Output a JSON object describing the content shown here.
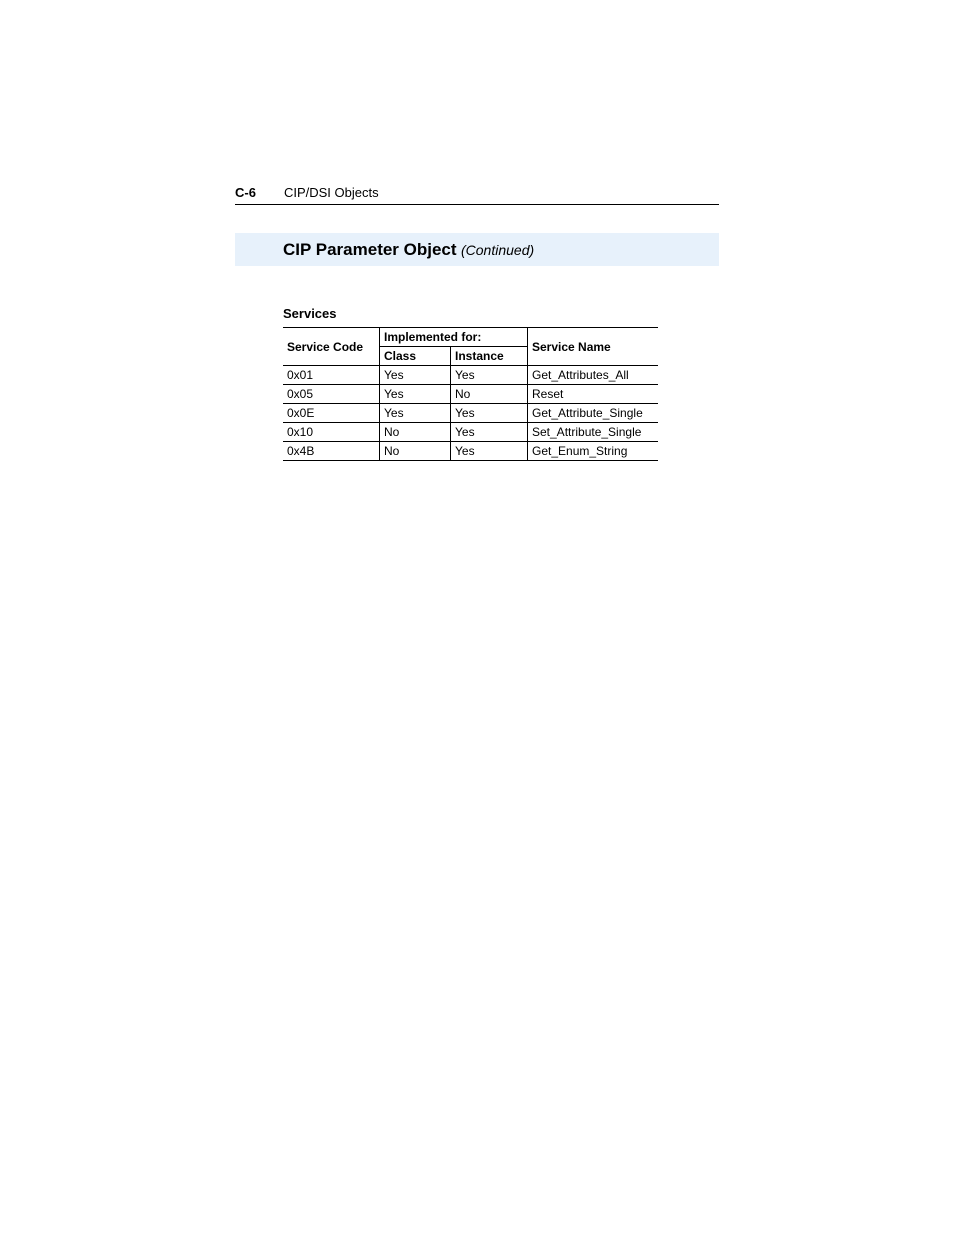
{
  "header": {
    "page_number": "C-6",
    "section": "CIP/DSI Objects"
  },
  "title": {
    "main": "CIP Parameter Object",
    "suffix": "(Continued)"
  },
  "table": {
    "heading": "Services",
    "headers": {
      "service_code": "Service Code",
      "implemented_for": "Implemented for:",
      "class": "Class",
      "instance": "Instance",
      "service_name": "Service Name"
    },
    "rows": [
      {
        "code": "0x01",
        "class": "Yes",
        "instance": "Yes",
        "name": "Get_Attributes_All"
      },
      {
        "code": "0x05",
        "class": "Yes",
        "instance": "No",
        "name": "Reset"
      },
      {
        "code": "0x0E",
        "class": "Yes",
        "instance": "Yes",
        "name": "Get_Attribute_Single"
      },
      {
        "code": "0x10",
        "class": "No",
        "instance": "Yes",
        "name": "Set_Attribute_Single"
      },
      {
        "code": "0x4B",
        "class": "No",
        "instance": "Yes",
        "name": "Get_Enum_String"
      }
    ]
  }
}
